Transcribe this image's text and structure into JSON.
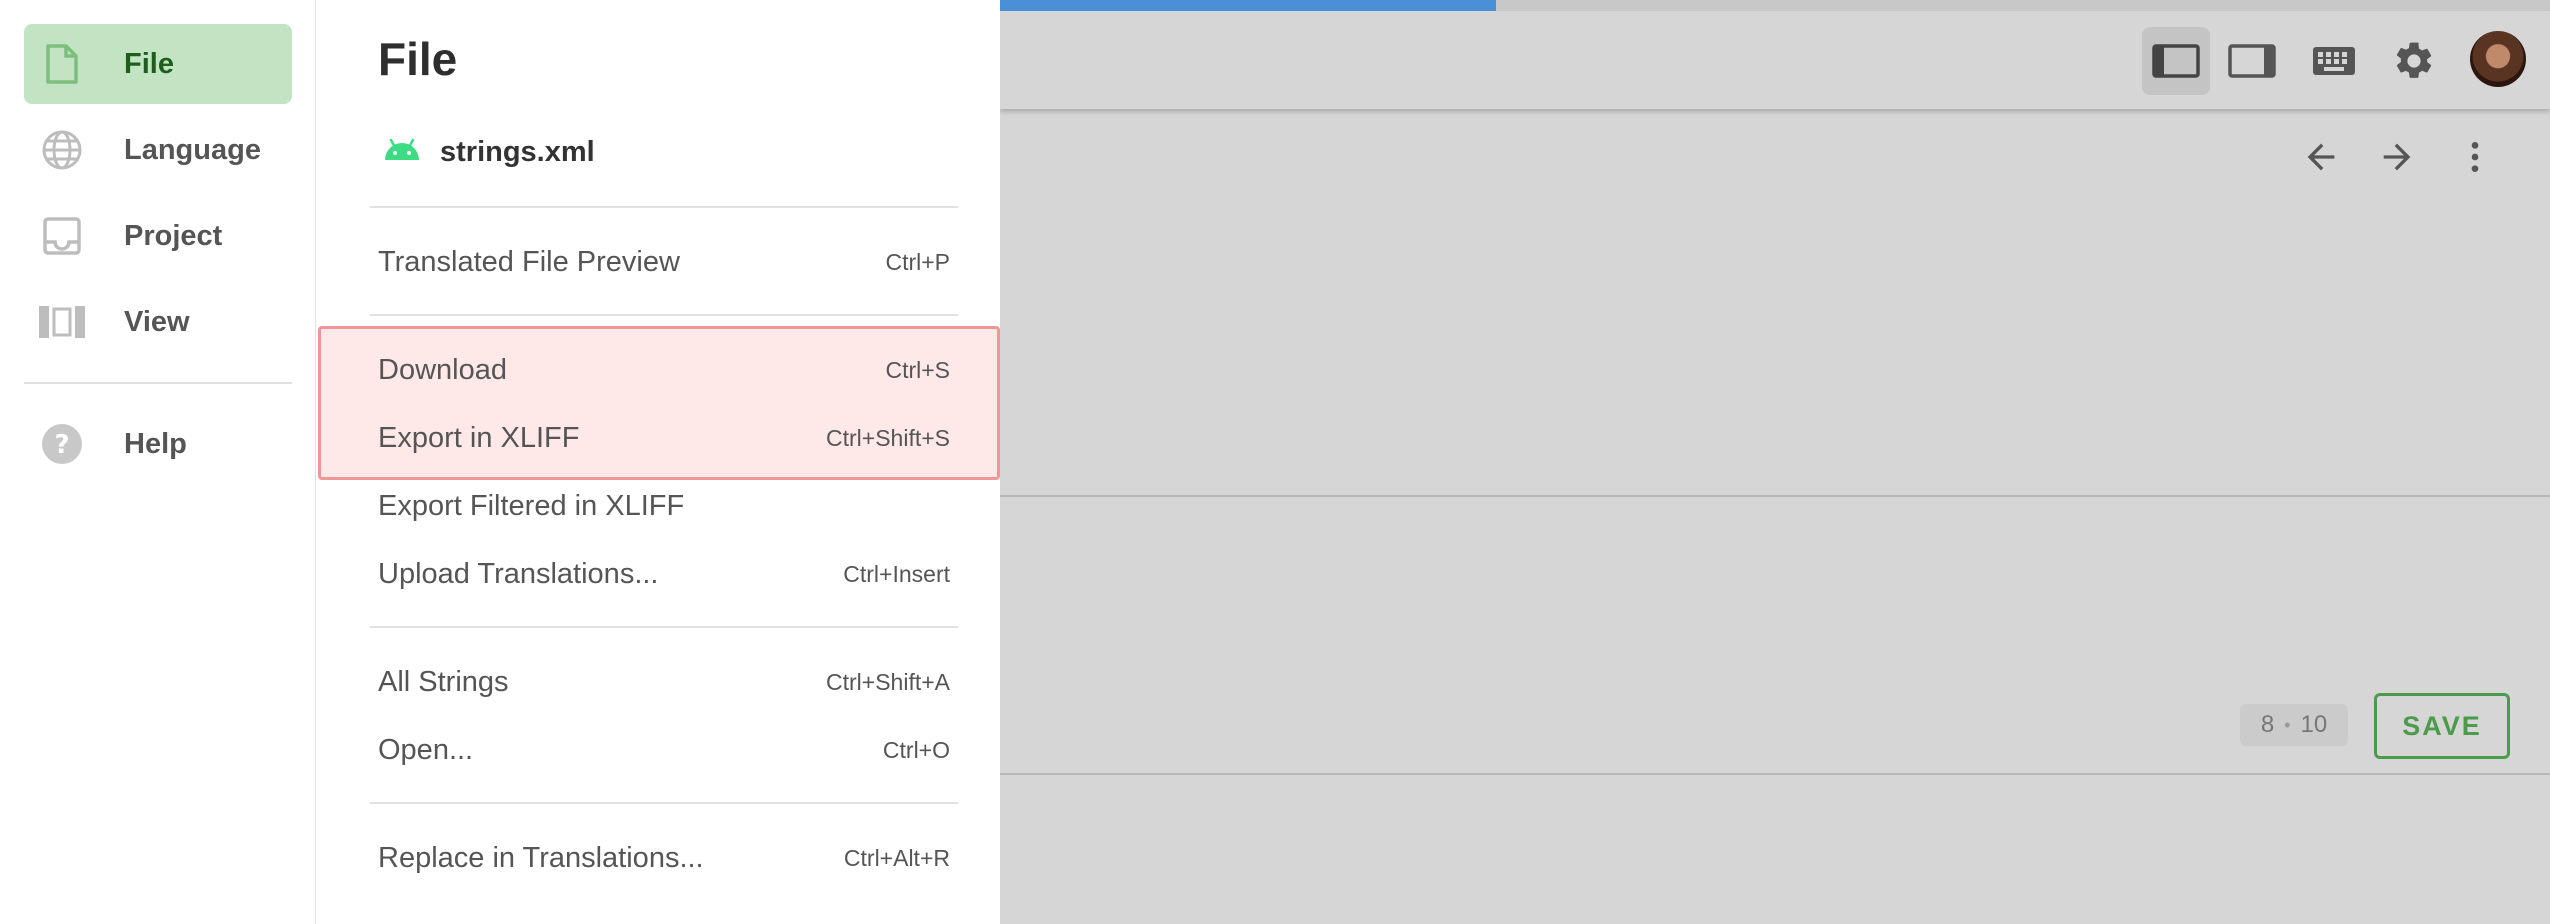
{
  "colors": {
    "accent_green": "#4c9a4c",
    "active_nav_bg": "#c2e4c2",
    "progress_blue": "#4a90d9",
    "highlight_bg": "#ffe8e8",
    "highlight_border": "#ef9696",
    "android_green": "#3ddc84"
  },
  "progress": {
    "fraction": 0.32
  },
  "sidebar": {
    "items": [
      {
        "label": "File",
        "icon": "file-icon",
        "active": true
      },
      {
        "label": "Language",
        "icon": "globe-icon",
        "active": false
      },
      {
        "label": "Project",
        "icon": "inbox-icon",
        "active": false
      },
      {
        "label": "View",
        "icon": "view-columns-icon",
        "active": false
      },
      {
        "label": "Help",
        "icon": "help-circle-icon",
        "active": false
      }
    ]
  },
  "file_panel": {
    "title": "File",
    "file_name": "strings.xml",
    "file_icon": "android-icon",
    "menu": [
      {
        "label": "Translated File Preview",
        "shortcut": "Ctrl+P"
      },
      {
        "label": "Download",
        "shortcut": "Ctrl+S"
      },
      {
        "label": "Export in XLIFF",
        "shortcut": "Ctrl+Shift+S"
      },
      {
        "label": "Export Filtered in XLIFF",
        "shortcut": ""
      },
      {
        "label": "Upload Translations...",
        "shortcut": "Ctrl+Insert"
      },
      {
        "label": "All Strings",
        "shortcut": "Ctrl+Shift+A"
      },
      {
        "label": "Open...",
        "shortcut": "Ctrl+O"
      },
      {
        "label": "Replace in Translations...",
        "shortcut": "Ctrl+Alt+R"
      }
    ]
  },
  "toolbar": {
    "icons": [
      "sidebar-left-icon",
      "sidebar-right-icon",
      "keyboard-icon",
      "gear-icon",
      "avatar"
    ]
  },
  "nav_icons": [
    "arrow-left-icon",
    "arrow-right-icon",
    "more-vertical-icon"
  ],
  "editor": {
    "counter_left": "8",
    "counter_separator": "•",
    "counter_right": "10",
    "save_label": "SAVE"
  }
}
